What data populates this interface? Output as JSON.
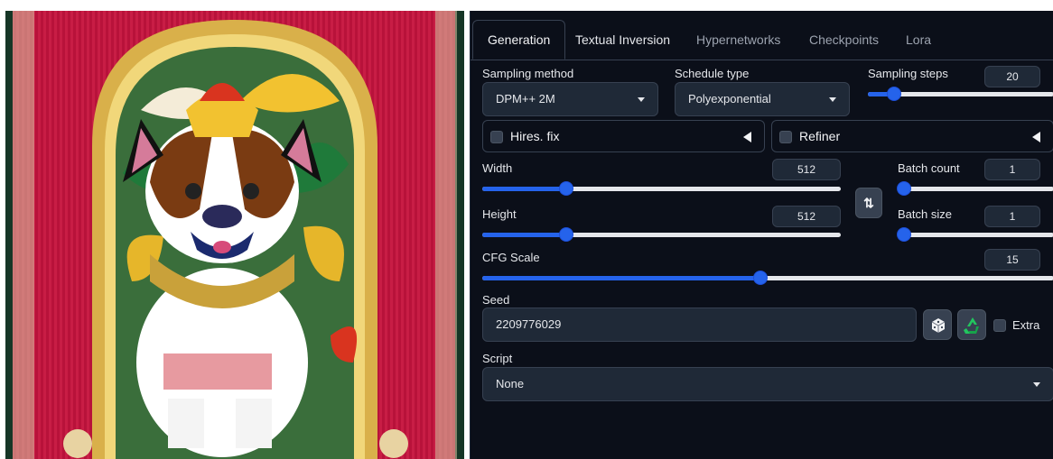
{
  "tabs": [
    {
      "label": "Generation",
      "active": true
    },
    {
      "label": "Textual Inversion",
      "active": false
    },
    {
      "label": "Hypernetworks",
      "active": false
    },
    {
      "label": "Checkpoints",
      "active": false
    },
    {
      "label": "Lora",
      "active": false
    }
  ],
  "sampling_method": {
    "label": "Sampling method",
    "value": "DPM++ 2M"
  },
  "schedule_type": {
    "label": "Schedule type",
    "value": "Polyexponential"
  },
  "sampling_steps": {
    "label": "Sampling steps",
    "value": "20",
    "fraction": 0.14
  },
  "hires_fix": {
    "label": "Hires. fix",
    "checked": false
  },
  "refiner": {
    "label": "Refiner",
    "checked": false
  },
  "width": {
    "label": "Width",
    "value": "512",
    "fraction": 0.235
  },
  "height": {
    "label": "Height",
    "value": "512",
    "fraction": 0.235
  },
  "batch_count": {
    "label": "Batch count",
    "value": "1",
    "fraction": 0.0
  },
  "batch_size": {
    "label": "Batch size",
    "value": "1",
    "fraction": 0.0
  },
  "cfg_scale": {
    "label": "CFG Scale",
    "value": "15",
    "fraction": 0.487
  },
  "seed": {
    "label": "Seed",
    "value": "2209776029"
  },
  "extra": {
    "label": "Extra",
    "checked": false
  },
  "script": {
    "label": "Script",
    "value": "None"
  },
  "swap_icon": "swap-dimensions-icon",
  "dice_icon": "dice-icon",
  "recycle_icon": "recycle-icon",
  "colors": {
    "accent": "#2563eb",
    "panel_bg": "#0b0f19",
    "input_bg": "#1f2937",
    "recycle": "#22c55e"
  }
}
